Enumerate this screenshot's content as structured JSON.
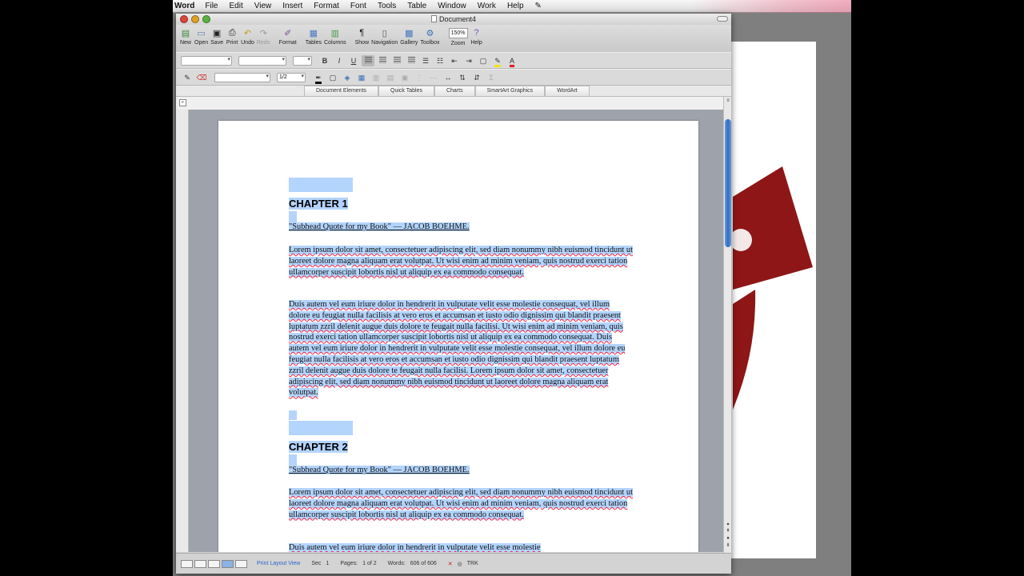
{
  "menubar": {
    "app": "Word",
    "items": [
      "File",
      "Edit",
      "View",
      "Insert",
      "Format",
      "Font",
      "Tools",
      "Table",
      "Window",
      "Work",
      "Help"
    ],
    "script_icon": "script-menu-icon"
  },
  "window": {
    "title": "Document4"
  },
  "toolbar": {
    "new": "New",
    "open": "Open",
    "save": "Save",
    "print": "Print",
    "undo": "Undo",
    "redo": "Redo",
    "format": "Format",
    "tables": "Tables",
    "columns": "Columns",
    "show": "Show",
    "navigation": "Navigation",
    "gallery": "Gallery",
    "toolbox": "Toolbox",
    "zoom": "Zoom",
    "zoom_value": "150%",
    "help": "Help"
  },
  "formatting": {
    "bold": "B",
    "italic": "I",
    "underline": "U",
    "line_spacing": "1/2"
  },
  "ribbon": {
    "tabs": [
      "Document Elements",
      "Quick Tables",
      "Charts",
      "SmartArt Graphics",
      "WordArt"
    ]
  },
  "document": {
    "chapter1": {
      "heading": "CHAPTER 1",
      "quote": "\"Subhead Quote for my Book\" — JACOB BOEHME.",
      "p1": "Lorem ipsum dolor sit amet, consectetuer adipiscing elit, sed diam nonummy nibh euismod tincidunt ut laoreet dolore magna aliquam erat volutpat. Ut wisi enim ad minim veniam, quis nostrud exerci tation ullamcorper suscipit lobortis nisl ut aliquip ex ea commodo consequat.",
      "p2": "Duis autem vel eum iriure dolor in hendrerit in vulputate velit esse molestie consequat, vel illum dolore eu feugiat nulla facilisis at vero eros et accumsan et iusto odio dignissim qui blandit praesent luptatum zzril delenit augue duis dolore te feugait nulla facilisi. Ut wisi enim ad minim veniam, quis nostrud exerci tation ullamcorper suscipit lobortis nisl ut aliquip ex ea commodo consequat. Duis autem vel eum iriure dolor in hendrerit in vulputate velit esse molestie consequat, vel illum dolore eu feugiat nulla facilisis at vero eros et accumsan et iusto odio dignissim qui blandit praesent luptatum zzril delenit augue duis dolore te feugait nulla facilisi. Lorem ipsum dolor sit amet, consectetuer adipiscing elit, sed diam nonummy nibh euismod tincidunt ut laoreet dolore magna aliquam erat volutpat."
    },
    "chapter2": {
      "heading": "CHAPTER 2",
      "quote": "\"Subhead Quote for my Book\" — JACOB BOEHME.",
      "p1": "Lorem ipsum dolor sit amet, consectetuer adipiscing elit, sed diam nonummy nibh euismod tincidunt ut laoreet dolore magna aliquam erat volutpat. Ut wisi enim ad minim veniam, quis nostrud exerci tation ullamcorper suscipit lobortis nisl ut aliquip ex ea commodo consequat.",
      "p2_start": "Duis autem vel eum iriure dolor in hendrerit in vulputate velit esse molestie"
    }
  },
  "status": {
    "view_name": "Print Layout View",
    "sec_label": "Sec",
    "sec_value": "1",
    "pages_label": "Pages:",
    "pages_value": "1 of 2",
    "words_label": "Words:",
    "words_value": "606 of 606",
    "trk": "TRK"
  },
  "colors": {
    "selection": "#b3d4fc",
    "accent": "#2e6cc4",
    "desktop_red": "#8e1616"
  }
}
